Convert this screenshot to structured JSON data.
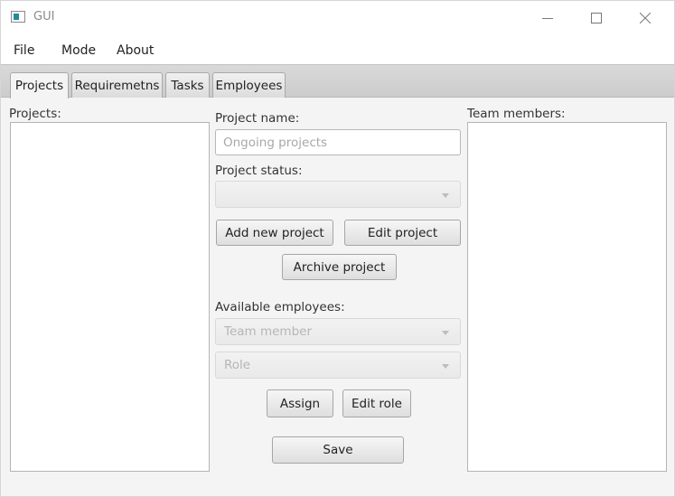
{
  "window": {
    "title": "GUI"
  },
  "menu": {
    "items": [
      "File",
      "Mode",
      "About"
    ]
  },
  "tabs": [
    {
      "label": "Projects",
      "active": true
    },
    {
      "label": "Requiremetns",
      "active": false
    },
    {
      "label": "Tasks",
      "active": false
    },
    {
      "label": "Employees",
      "active": false
    }
  ],
  "left_panel": {
    "label": "Projects:"
  },
  "center": {
    "project_name_label": "Project name:",
    "project_name_placeholder": "Ongoing projects",
    "project_name_value": "",
    "project_status_label": "Project status:",
    "project_status_value": "",
    "add_button": "Add new project",
    "edit_button": "Edit project",
    "archive_button": "Archive project",
    "available_employees_label": "Available employees:",
    "team_member_combo": "Team member",
    "role_combo": "Role",
    "assign_button": "Assign",
    "edit_role_button": "Edit role",
    "save_button": "Save"
  },
  "right_panel": {
    "label": "Team members:"
  }
}
